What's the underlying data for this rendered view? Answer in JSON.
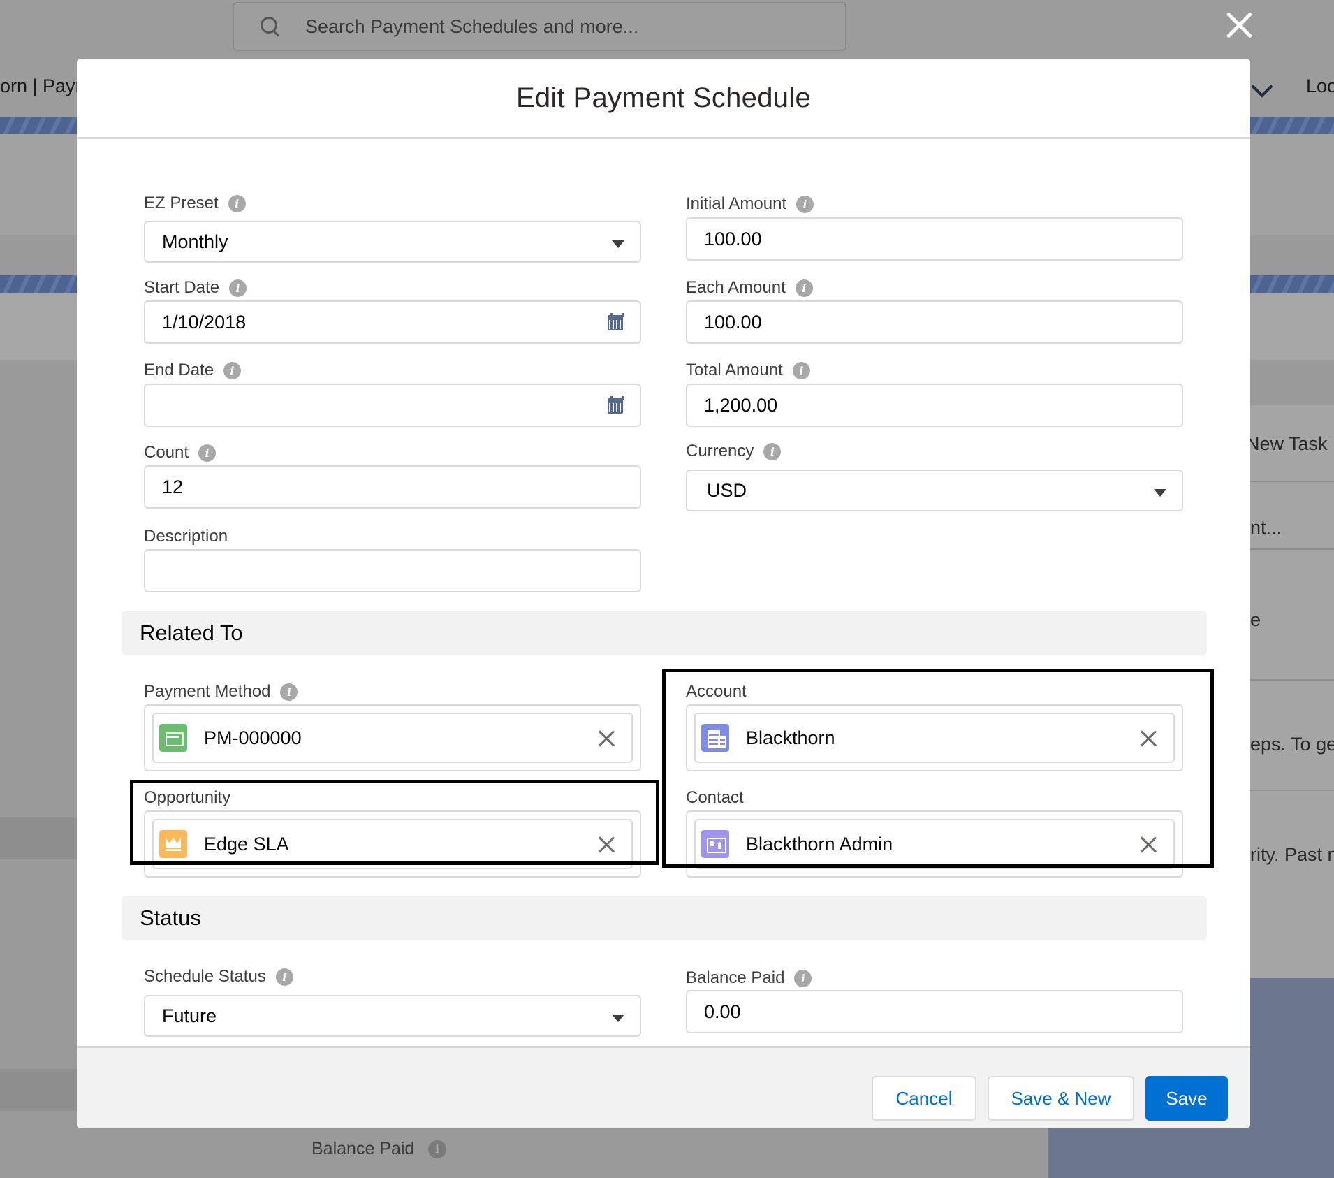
{
  "background": {
    "search_placeholder": "Search Payment Schedules and more...",
    "tab_left_fragment": "orn | Paym",
    "tab_right_fragment": "Loc",
    "side_texts": [
      "New Task",
      "nt...",
      "e",
      "eps. To get",
      "rity. Past m"
    ],
    "bottom_label": "Balance Paid"
  },
  "modal": {
    "title": "Edit Payment Schedule",
    "fields": {
      "ez_preset": {
        "label": "EZ Preset",
        "value": "Monthly"
      },
      "start_date": {
        "label": "Start Date",
        "value": "1/10/2018"
      },
      "end_date": {
        "label": "End Date",
        "value": ""
      },
      "count": {
        "label": "Count",
        "value": "12"
      },
      "description": {
        "label": "Description",
        "value": ""
      },
      "initial_amount": {
        "label": "Initial Amount",
        "value": "100.00"
      },
      "each_amount": {
        "label": "Each Amount",
        "value": "100.00"
      },
      "total_amount": {
        "label": "Total Amount",
        "value": "1,200.00"
      },
      "currency": {
        "label": "Currency",
        "value": "USD"
      }
    },
    "related": {
      "heading": "Related To",
      "payment_method": {
        "label": "Payment Method",
        "value": "PM-000000",
        "icon": "payment-card-icon"
      },
      "opportunity": {
        "label": "Opportunity",
        "value": "Edge SLA",
        "icon": "crown-icon"
      },
      "account": {
        "label": "Account",
        "value": "Blackthorn",
        "icon": "building-icon"
      },
      "contact": {
        "label": "Contact",
        "value": "Blackthorn Admin",
        "icon": "contact-card-icon"
      }
    },
    "status": {
      "heading": "Status",
      "schedule_status": {
        "label": "Schedule Status",
        "value": "Future"
      },
      "balance_paid": {
        "label": "Balance Paid",
        "value": "0.00"
      }
    },
    "footer": {
      "cancel": "Cancel",
      "save_new": "Save & New",
      "save": "Save"
    }
  },
  "colors": {
    "brand": "#0070d2",
    "border": "#dddbda",
    "highlight": "#000000"
  }
}
